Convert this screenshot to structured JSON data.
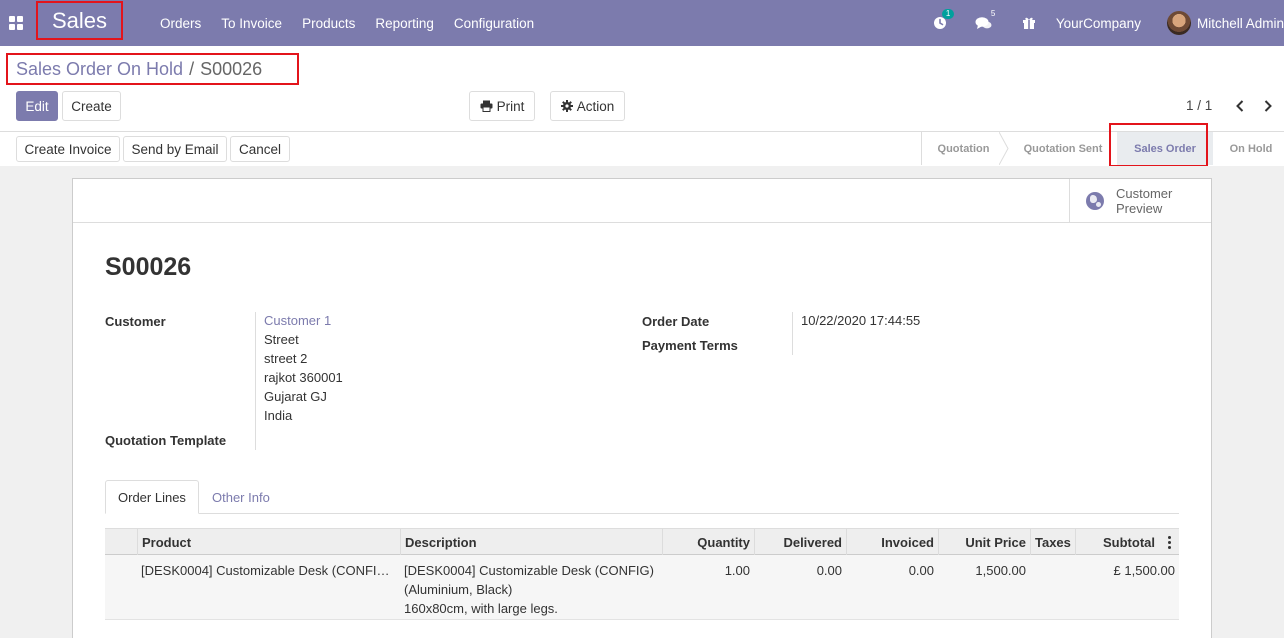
{
  "navbar": {
    "app_name": "Sales",
    "menu": [
      "Orders",
      "To Invoice",
      "Products",
      "Reporting",
      "Configuration"
    ],
    "activity_count": "1",
    "messages_count": "5",
    "company": "YourCompany",
    "user": "Mitchell Admin"
  },
  "breadcrumb": {
    "parent": "Sales Order On Hold",
    "separator": "/",
    "current": "S00026"
  },
  "control_panel": {
    "edit": "Edit",
    "create": "Create",
    "print": "Print",
    "action": "Action",
    "pager": "1 / 1"
  },
  "header_buttons": {
    "create_invoice": "Create Invoice",
    "send_email": "Send by Email",
    "cancel": "Cancel"
  },
  "statusbar": {
    "stages": [
      "Quotation",
      "Quotation Sent",
      "Sales Order",
      "On Hold"
    ],
    "current": "Sales Order"
  },
  "button_box": {
    "customer_preview": "Customer Preview"
  },
  "order": {
    "name": "S00026",
    "customer_label": "Customer",
    "customer_name": "Customer 1",
    "address": [
      "Street",
      "street 2",
      "rajkot 360001",
      "Gujarat GJ",
      "India"
    ],
    "quotation_template_label": "Quotation Template",
    "order_date_label": "Order Date",
    "order_date": "10/22/2020 17:44:55",
    "payment_terms_label": "Payment Terms"
  },
  "tabs": [
    "Order Lines",
    "Other Info"
  ],
  "table": {
    "headers": [
      "Product",
      "Description",
      "Quantity",
      "Delivered",
      "Invoiced",
      "Unit Price",
      "Taxes",
      "Subtotal"
    ],
    "rows": [
      {
        "product": "[DESK0004] Customizable Desk (CONFI…",
        "description": [
          "[DESK0004] Customizable Desk (CONFIG)",
          "(Aluminium, Black)",
          "160x80cm, with large legs."
        ],
        "quantity": "1.00",
        "delivered": "0.00",
        "invoiced": "0.00",
        "unit_price": "1,500.00",
        "taxes": "",
        "subtotal": "£ 1,500.00"
      }
    ]
  },
  "colors": {
    "brand": "#7c7bad",
    "highlight": "#e3141b",
    "badge": "#00a09d"
  }
}
